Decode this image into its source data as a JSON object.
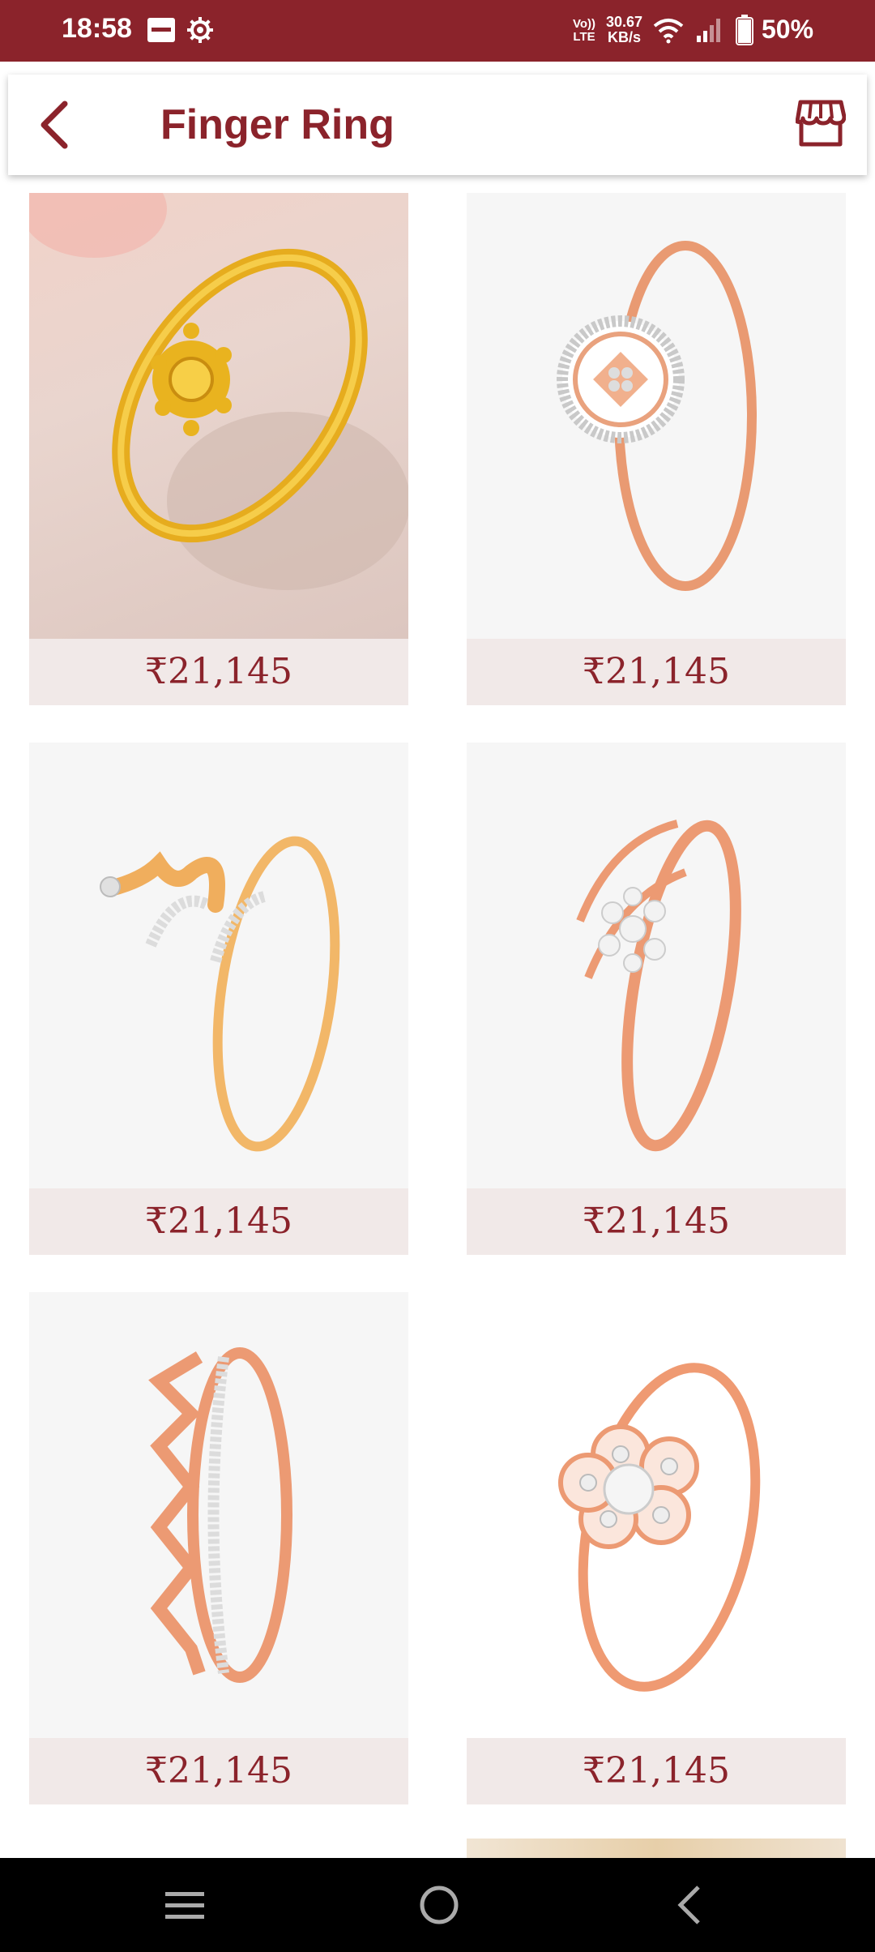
{
  "status_bar": {
    "time": "18:58",
    "volte_line1": "Vo))",
    "volte_line2": "LTE",
    "speed_line1": "30.67",
    "speed_line2": "KB/s",
    "battery": "50%",
    "icons": [
      "note-icon",
      "gear-icon",
      "wifi-icon",
      "signal-icon",
      "battery-icon"
    ]
  },
  "app_bar": {
    "title": "Finger Ring",
    "icons": [
      "back-arrow-icon",
      "store-icon"
    ],
    "accent_color": "#8B232B"
  },
  "products": [
    {
      "price": "₹21,145",
      "image": "yellow-gold-floral-ring"
    },
    {
      "price": "₹21,145",
      "image": "rose-gold-halo-diamond-ring"
    },
    {
      "price": "₹21,145",
      "image": "gold-wave-diamond-ring"
    },
    {
      "price": "₹21,145",
      "image": "rose-gold-cluster-diamond-ring"
    },
    {
      "price": "₹21,145",
      "image": "rose-gold-zigzag-diamond-ring"
    },
    {
      "price": "₹21,145",
      "image": "rose-gold-flower-diamond-ring"
    }
  ],
  "nav_bar": {
    "icons": [
      "menu-icon",
      "home-icon",
      "back-icon"
    ]
  }
}
